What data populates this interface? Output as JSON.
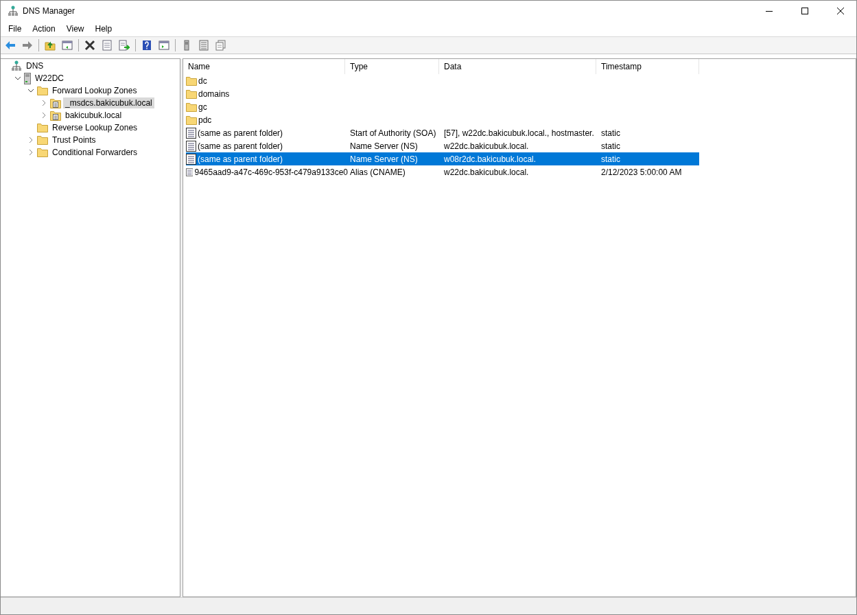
{
  "window": {
    "title": "DNS Manager"
  },
  "menu": [
    "File",
    "Action",
    "View",
    "Help"
  ],
  "toolbar": [
    {
      "kind": "back"
    },
    {
      "kind": "forward"
    },
    {
      "kind": "sep"
    },
    {
      "kind": "up"
    },
    {
      "kind": "tree"
    },
    {
      "kind": "sep"
    },
    {
      "kind": "delete"
    },
    {
      "kind": "properties"
    },
    {
      "kind": "export"
    },
    {
      "kind": "sep"
    },
    {
      "kind": "help"
    },
    {
      "kind": "pane"
    },
    {
      "kind": "sep"
    },
    {
      "kind": "server"
    },
    {
      "kind": "list"
    },
    {
      "kind": "copy"
    }
  ],
  "tree": [
    {
      "label": "DNS",
      "kind": "dns",
      "selected": false,
      "children": [
        {
          "label": "W22DC",
          "kind": "server",
          "expanded": true,
          "selected": false,
          "children": [
            {
              "label": "Forward Lookup Zones",
              "kind": "folder",
              "expanded": true,
              "selected": false,
              "children": [
                {
                  "label": "_msdcs.bakicubuk.local",
                  "kind": "zone",
                  "expanded": false,
                  "selected": true
                },
                {
                  "label": "bakicubuk.local",
                  "kind": "zone",
                  "expanded": false,
                  "selected": false
                }
              ]
            },
            {
              "label": "Reverse Lookup Zones",
              "kind": "folder",
              "selected": false
            },
            {
              "label": "Trust Points",
              "kind": "folder",
              "expanded": false,
              "selected": false
            },
            {
              "label": "Conditional Forwarders",
              "kind": "folder",
              "expanded": false,
              "selected": false
            }
          ]
        }
      ]
    }
  ],
  "table": {
    "columns": [
      "Name",
      "Type",
      "Data",
      "Timestamp"
    ],
    "rows": [
      {
        "kind": "folder",
        "selected": false,
        "cells": [
          "dc"
        ]
      },
      {
        "kind": "folder",
        "selected": false,
        "cells": [
          "domains"
        ]
      },
      {
        "kind": "folder",
        "selected": false,
        "cells": [
          "gc"
        ]
      },
      {
        "kind": "folder",
        "selected": false,
        "cells": [
          "pdc"
        ]
      },
      {
        "kind": "record",
        "selected": false,
        "cells": [
          "(same as parent folder)",
          "Start of Authority (SOA)",
          "[57], w22dc.bakicubuk.local., hostmaster.",
          "static"
        ]
      },
      {
        "kind": "record",
        "selected": false,
        "cells": [
          "(same as parent folder)",
          "Name Server (NS)",
          "w22dc.bakicubuk.local.",
          "static"
        ]
      },
      {
        "kind": "record",
        "selected": true,
        "cells": [
          "(same as parent folder)",
          "Name Server (NS)",
          "w08r2dc.bakicubuk.local.",
          "static"
        ]
      },
      {
        "kind": "record",
        "selected": false,
        "cells": [
          "9465aad9-a47c-469c-953f-c479a9133ce0",
          "Alias (CNAME)",
          "w22dc.bakicubuk.local.",
          "2/12/2023 5:00:00 AM"
        ]
      }
    ]
  }
}
